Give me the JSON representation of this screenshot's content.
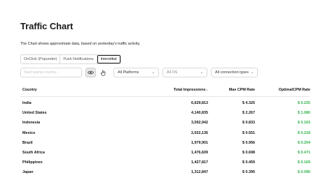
{
  "page": {
    "title": "Traffic Chart",
    "subtitle": "The Chart shows approximate data, based on yesterday's traffic activity."
  },
  "tabs": [
    {
      "label": "OnClick (Popunder)",
      "active": false
    },
    {
      "label": "Push Notifications",
      "active": false
    },
    {
      "label": "Interstitial",
      "active": true
    }
  ],
  "filters": {
    "search_placeholder": "Start typing country...",
    "eye_icon": "eye-icon",
    "hand_icon": "hand-icon",
    "platforms": "All Platforms",
    "os": "All OS",
    "connection": "All connection types"
  },
  "table": {
    "headers": {
      "country": "Country",
      "impressions": "Total Impressions",
      "sort_arrow": "↓",
      "cpm": "Max CPM Rate",
      "optimal": "OptimalCPM Rate"
    },
    "rows": [
      {
        "country": "India",
        "impressions": "6,629,813",
        "cpm": "$ 4.325",
        "optimal": "$ 0.225"
      },
      {
        "country": "United States",
        "impressions": "4,140,835",
        "cpm": "$ 2.267",
        "optimal": "$ 1.080"
      },
      {
        "country": "Indonesia",
        "impressions": "3,592,942",
        "cpm": "$ 0.833",
        "optimal": "$ 0.163"
      },
      {
        "country": "Mexico",
        "impressions": "2,022,136",
        "cpm": "$ 0.551",
        "optimal": "$ 0.218"
      },
      {
        "country": "Brazil",
        "impressions": "1,979,901",
        "cpm": "$ 0.956",
        "optimal": "$ 0.204"
      },
      {
        "country": "South Africa",
        "impressions": "1,476,609",
        "cpm": "$ 0.698",
        "optimal": "$ 0.471"
      },
      {
        "country": "Philippines",
        "impressions": "1,427,817",
        "cpm": "$ 0.459",
        "optimal": "$ 0.169"
      },
      {
        "country": "Japan",
        "impressions": "1,312,847",
        "cpm": "$ 0.395",
        "optimal": "$ 0.090"
      }
    ]
  },
  "colors": {
    "accent_green": "#2fb24c",
    "active_tab_border": "#1a1a1a"
  }
}
